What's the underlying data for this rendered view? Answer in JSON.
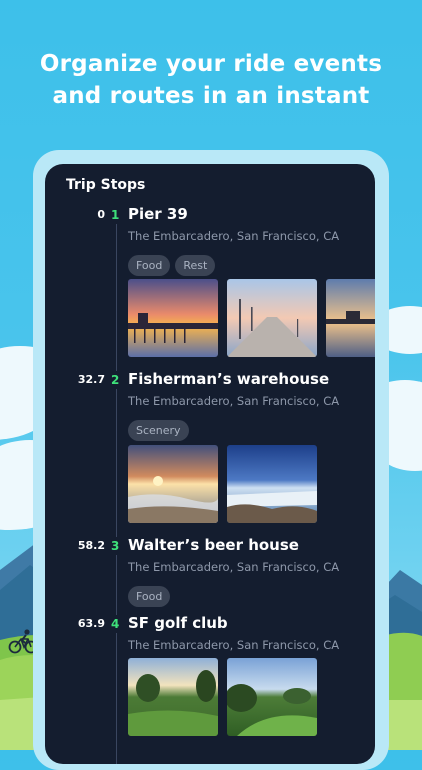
{
  "headline": {
    "line1": "Organize your ride events",
    "line2": "and routes in an instant"
  },
  "screen": {
    "title": "Trip Stops",
    "stops": [
      {
        "distance": "0",
        "index": "1",
        "name": "Pier 39",
        "address": "The Embarcadero, San Francisco, CA",
        "tags": [
          "Food",
          "Rest"
        ]
      },
      {
        "distance": "32.7",
        "index": "2",
        "name": "Fisherman’s warehouse",
        "address": "The Embarcadero, San Francisco, CA",
        "tags": [
          "Scenery"
        ]
      },
      {
        "distance": "58.2",
        "index": "3",
        "name": "Walter’s beer house",
        "address": "The Embarcadero, San Francisco, CA",
        "tags": [
          "Food"
        ]
      },
      {
        "distance": "63.9",
        "index": "4",
        "name": "SF golf club",
        "address": "The Embarcadero, San Francisco, CA",
        "tags": []
      }
    ]
  },
  "icons": [
    "cyclist-icon"
  ],
  "colors": {
    "accent": "#3ee07a",
    "screen_bg": "#141d2f",
    "sky": "#3dc0ea"
  }
}
